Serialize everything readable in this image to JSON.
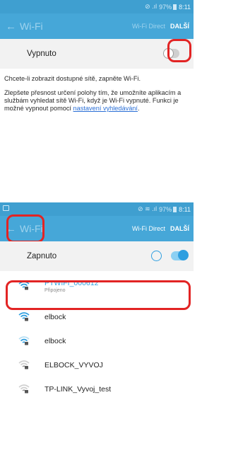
{
  "screen1": {
    "status": {
      "signal": "⊘ .ıl",
      "battery": "97%",
      "time": "8:11"
    },
    "appbar": {
      "title": "Wi-Fi",
      "direct": "Wi-Fi Direct",
      "more": "DALŠÍ"
    },
    "toggle": {
      "label": "Vypnuto",
      "state": "off"
    },
    "para1": "Chcete-li zobrazit dostupné sítě, zapněte Wi-Fi.",
    "para2_text": "Zlepšete přesnost určení polohy tím, že umožníte aplikacím a službám vyhledat sítě Wi-Fi, když je Wi-Fi vypnuté. Funkci je možné vypnout pomocí ",
    "para2_link": "nastavení vyhledávání",
    "para2_end": "."
  },
  "screen2": {
    "status": {
      "signal": "⊘ ≋ .ıl",
      "battery": "97%",
      "time": "8:11"
    },
    "appbar": {
      "title": "Wi-Fi",
      "direct": "Wi-Fi Direct",
      "more": "DALŠÍ"
    },
    "toggle": {
      "label": "Zapnuto",
      "state": "on"
    },
    "networks": [
      {
        "name": "PTWIFI_000612",
        "status": "Připojeno",
        "connected": true,
        "strength": "full"
      },
      {
        "name": "elbock",
        "strength": "full"
      },
      {
        "name": "elbock",
        "strength": "medium"
      },
      {
        "name": "ELBOCK_VYVOJ",
        "strength": "low"
      },
      {
        "name": "TP-LINK_Vyvoj_test",
        "strength": "low"
      }
    ]
  },
  "colors": {
    "statusbar": "#3f9fd0",
    "appbar": "#46a7d8",
    "accent": "#2f9fe0",
    "highlight": "#e22424"
  },
  "icons": [
    "back-arrow-icon",
    "wifi-lock-icon",
    "circle-icon",
    "toggle-switch-icon"
  ]
}
